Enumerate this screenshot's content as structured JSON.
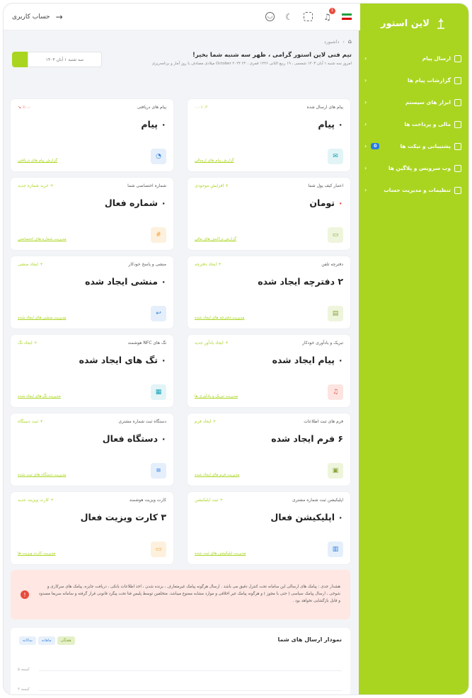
{
  "sidebar": {
    "brand": "لاین استور",
    "items": [
      {
        "label": "ارسال پیام",
        "chev": "‹"
      },
      {
        "label": "گزارشات پیام ها",
        "chev": "‹"
      },
      {
        "label": "ابزار های سیستم",
        "chev": "‹"
      },
      {
        "label": "مالی و پرداخت ها",
        "chev": "‹"
      },
      {
        "label": "پشتیبانی و تیکت ها",
        "chev": "‹",
        "badge": "0"
      },
      {
        "label": "وب سرویس و پلاگین ها",
        "chev": "‹"
      },
      {
        "label": "تنظیمات و مدیریت حساب",
        "chev": "‹"
      }
    ]
  },
  "topbar": {
    "title": "حساب کاربری",
    "back_icon": "→",
    "notif_count": "1"
  },
  "breadcrumb": {
    "home_icon": "⌂",
    "sep": "‹",
    "label": "داشبورد"
  },
  "welcome": {
    "title": "تیم فنی لاین استور گرامی ، ظهر سه شنبه شما بخیر!",
    "sub": "امروز سه شنبه ۱ آبان ۱۴۰۳ شمسی ، ۱۹ ربیع الثانی ۱۴۴۶ قمری ، ۲۲ October ۲۰۲۴ میلادی مصادف با روز آمار و برنامه‌ریزی",
    "date": "سه شنبه ۱ آبان ۱۴۰۳"
  },
  "cards": [
    {
      "title": "پیام های ارسال شده",
      "action": "↗ ۰.۰٪",
      "value": "۰ پیام",
      "link": "گزارش پیام های ارسالی",
      "icon_glyph": "✉",
      "icon_name": "mail-icon",
      "color": "#17a2b8",
      "bg": "#e2f4f6"
    },
    {
      "title": "پیام های دریافتی",
      "action": "٪۰.۰ ↘",
      "value": "۰ پیام",
      "link": "گزارش پیام های دریافتی",
      "icon_glyph": "◔",
      "icon_name": "chat-icon",
      "color": "#2a7de1",
      "bg": "#e5effb",
      "action_red": true
    },
    {
      "title": "اعتبار کیف پول شما",
      "action": "+ افزایش موجودی",
      "value": "تومان",
      "dot": "۰",
      "link": "گزارش تراکنش های مالی",
      "icon_glyph": "▭",
      "icon_name": "wallet-icon",
      "color": "#8aa33a",
      "bg": "#eef5dc"
    },
    {
      "title": "شماره اختصاصی شما",
      "action": "+ خرید شماره جدید",
      "value": "۰ شماره فعال",
      "link": "مدیریت شماره های اختصاصی",
      "icon_glyph": "#",
      "icon_name": "hash-icon",
      "color": "#f0a030",
      "bg": "#fdf1de"
    },
    {
      "title": "دفترچه تلفن",
      "action": "+ ایجاد دفترچه",
      "value": "۲ دفترچه ایجاد شده",
      "link": "مدیریت دفترچه های ایجاد شده",
      "icon_glyph": "▤",
      "icon_name": "phonebook-icon",
      "color": "#8aa33a",
      "bg": "#eef5dc"
    },
    {
      "title": "منشی و پاسخ خودکار",
      "action": "+ ایجاد منشی",
      "value": "۰ منشی ایجاد شده",
      "link": "مدیریت منشی های ایجاد شده",
      "icon_glyph": "↩",
      "icon_name": "reply-icon",
      "color": "#2a7de1",
      "bg": "#e5effb"
    },
    {
      "title": "تبریک و یادآوری خودکار",
      "action": "+ ایجاد یادآور جدید",
      "value": "۰ پیام ایجاد شده",
      "link": "مدیریت تبریک و یادآوری ها",
      "icon_glyph": "♫",
      "icon_name": "bell-icon",
      "color": "#e74c3c",
      "bg": "#fde4e1"
    },
    {
      "title": "تگ های NFC هوشمند",
      "action": "+ ایجاد تگ",
      "value": "۰ تگ های ایجاد شده",
      "link": "مدیریت تگ های ایجاد شده",
      "icon_glyph": "▦",
      "icon_name": "nfc-icon",
      "color": "#17a2b8",
      "bg": "#e2f4f6"
    },
    {
      "title": "فرم های ثبت اطلاعات",
      "action": "+ ایجاد فرم",
      "value": "۶ فرم ایجاد شده",
      "link": "مدیریت فرم های ایجاد شده",
      "icon_glyph": "▣",
      "icon_name": "form-icon",
      "color": "#8aa33a",
      "bg": "#eef5dc"
    },
    {
      "title": "دستگاه ثبت شماره مشتری",
      "action": "+ ثبت دستگاه",
      "value": "۰ دستگاه فعال",
      "link": "مدیریت دستگاه های ثبت شده",
      "icon_glyph": "≡",
      "icon_name": "device-icon",
      "color": "#2a7de1",
      "bg": "#e5effb"
    },
    {
      "title": "اپلیکیشن ثبت شماره مشتری",
      "action": "+ ثبت اپلیکیشن",
      "value": "۰ اپلیکیشن فعال",
      "link": "مدیریت اپلیکیشن های ثبت شده",
      "icon_glyph": "▥",
      "icon_name": "app-icon",
      "color": "#2a7de1",
      "bg": "#e5effb"
    },
    {
      "title": "کارت ویزیت هوشمند",
      "action": "+ کارت ویزیت جدید",
      "value": "۳ کارت ویزیت فعال",
      "link": "مدیریت کارت ویزیت ها",
      "icon_glyph": "▭",
      "icon_name": "card-icon",
      "color": "#f0a030",
      "bg": "#fdf1de"
    }
  ],
  "alert": {
    "icon": "!",
    "text": "هشدار جدی : پیامک های ارسالی این سامانه تحت کنترل دقیق می باشد . ارسال هرگونه پیامک غیرمتعارف ، برنده شدن ، اخذ اطلاعات بانکی ، دریافت جایزه، پیامک های سرکاری و شوخی ، ارسال پیامک سیاسی ( حتی با مجوز ) و هرگونه پیامک غیر اخلاقی و موارد مشابه ممنوع میباشد. متخلفین توسط پلیس فتا تحت پیگرد قانونی قرار گرفته و سامانه سریعا مسدود و قابل بازگشایی نخواهد بود ."
  },
  "chart": {
    "title": "نمودار ارسال های شما",
    "tabs": [
      "سالانه",
      "ماهانه",
      "هفتگی"
    ],
    "active_tab": 2,
    "y_labels": [
      "کیسه ۵",
      "کیسه ۴"
    ]
  },
  "colors": {
    "brand": "#a9d520",
    "danger": "#e74c3c"
  }
}
